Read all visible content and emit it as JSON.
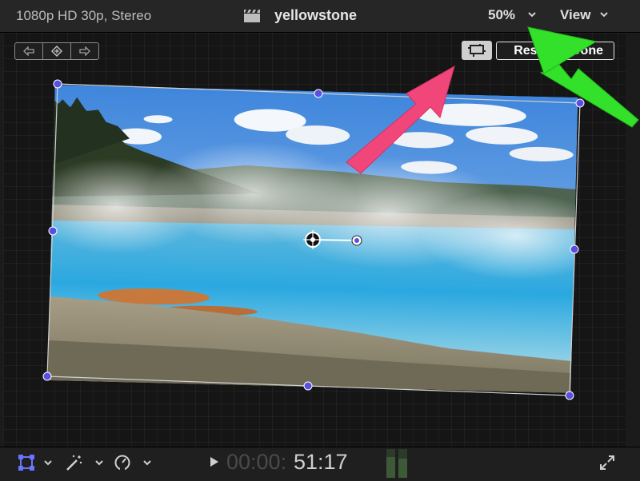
{
  "header": {
    "format": "1080p HD 30p, Stereo",
    "project_title": "yellowstone",
    "zoom_level": "50%",
    "view_label": "View"
  },
  "viewer": {
    "reset_label": "Reset",
    "done_label": "Done"
  },
  "transport": {
    "timecode_dim": "00:00:",
    "timecode_lit": "51:17"
  },
  "colors": {
    "handle": "#5a4fe0",
    "annotation_pink": "#f0467a",
    "annotation_green": "#33e02a",
    "tool_blue": "#6a74ff"
  },
  "icons": [
    "clapperboard-icon",
    "chevron-down-icon",
    "prev-keyframe-icon",
    "add-keyframe-icon",
    "next-keyframe-icon",
    "crop-icon",
    "transform-icon",
    "magic-wand-icon",
    "speedometer-icon",
    "play-icon",
    "fullscreen-icon"
  ]
}
